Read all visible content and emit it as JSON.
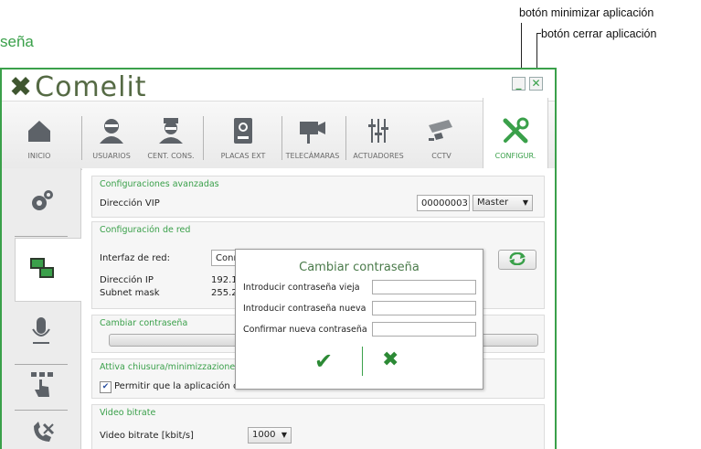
{
  "annotations": {
    "minimize_label": "botón minimizar aplicación",
    "close_label": "botón cerrar aplicación",
    "page_title": "seña"
  },
  "window": {
    "logo_text": "Comelit",
    "minimize_glyph": "_",
    "close_glyph": "✕"
  },
  "toolbar": [
    {
      "label": "INICIO",
      "icon": "home-icon"
    },
    {
      "label": "USUARIOS",
      "icon": "user-icon"
    },
    {
      "label": "CENT. CONS.",
      "icon": "concierge-icon"
    },
    {
      "label": "PLACAS EXT",
      "icon": "door-panel-icon"
    },
    {
      "label": "TELECÁMARAS",
      "icon": "camera-icon"
    },
    {
      "label": "ACTUADORES",
      "icon": "sliders-icon"
    },
    {
      "label": "CCTV",
      "icon": "cctv-icon"
    },
    {
      "label": "CONFIGUR.",
      "icon": "tools-icon",
      "active": true
    }
  ],
  "sidebar": [
    {
      "icon": "gears-icon"
    },
    {
      "icon": "network-icon",
      "active": true
    },
    {
      "icon": "microphone-icon"
    },
    {
      "icon": "touch-icon"
    },
    {
      "icon": "phone-tools-icon"
    }
  ],
  "sections": {
    "advanced": {
      "title": "Configuraciones avanzadas",
      "vip_label": "Dirección VIP",
      "vip_value": "00000003",
      "role_value": "Master"
    },
    "network": {
      "title": "Configuración de red",
      "interface_label": "Interfaz de red:",
      "interface_value": "Conn",
      "ip_label": "Dirección IP",
      "ip_value": "192.1",
      "mask_label": "Subnet mask",
      "mask_value": "255.2"
    },
    "password": {
      "title": "Cambiar contraseña"
    },
    "minimize": {
      "title": "Attiva chiusura/minimizzazione a",
      "checkbox_label": "Permitir que la aplicación de"
    },
    "video": {
      "title": "Video bitrate",
      "bitrate_label": "Video bitrate [kbit/s]",
      "bitrate_value": "1000"
    }
  },
  "dialog": {
    "title": "Cambiar contraseña",
    "old_label": "Introducir contraseña vieja",
    "new_label": "Introducir contraseña nueva",
    "confirm_label": "Confirmar nueva contraseña",
    "ok_glyph": "✔",
    "cancel_glyph": "✖"
  },
  "colors": {
    "accent": "#3aa04a",
    "logo": "#556a44"
  }
}
